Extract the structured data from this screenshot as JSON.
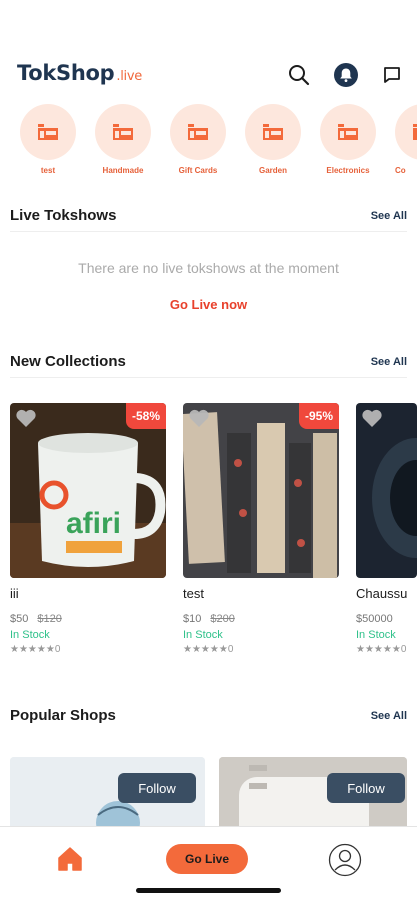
{
  "header": {
    "logo_main": "TokShop",
    "logo_suffix": ".live",
    "icons": [
      "search-icon",
      "notification-bell-icon",
      "chat-icon"
    ]
  },
  "categories": [
    {
      "label": "test"
    },
    {
      "label": "Handmade"
    },
    {
      "label": "Gift Cards"
    },
    {
      "label": "Garden"
    },
    {
      "label": "Electronics"
    },
    {
      "label": "Co"
    }
  ],
  "live_tokshows": {
    "title": "Live Tokshows",
    "see_all": "See All",
    "empty_message": "There are no live tokshows at the moment",
    "go_live_link": "Go Live now"
  },
  "new_collections": {
    "title": "New Collections",
    "see_all": "See All",
    "products": [
      {
        "name": "iii",
        "discount": "-58%",
        "price": "$50",
        "old_price": "$120",
        "stock": "In Stock",
        "rating": "★★★★★0"
      },
      {
        "name": "test",
        "discount": "-95%",
        "price": "$10",
        "old_price": "$200",
        "stock": "In Stock",
        "rating": "★★★★★0"
      },
      {
        "name": "Chaussu",
        "discount": "",
        "price": "$50000",
        "old_price": "",
        "stock": "In Stock",
        "rating": "★★★★★0"
      }
    ]
  },
  "popular_shops": {
    "title": "Popular Shops",
    "see_all": "See All",
    "shops": [
      {
        "follow_label": "Follow"
      },
      {
        "follow_label": "Follow"
      }
    ]
  },
  "bottom_nav": {
    "go_live_label": "Go Live"
  },
  "colors": {
    "brand_orange": "#f36a3b",
    "brand_navy": "#1f3550",
    "discount_red": "#f0483c",
    "in_stock_green": "#2fc18a"
  }
}
